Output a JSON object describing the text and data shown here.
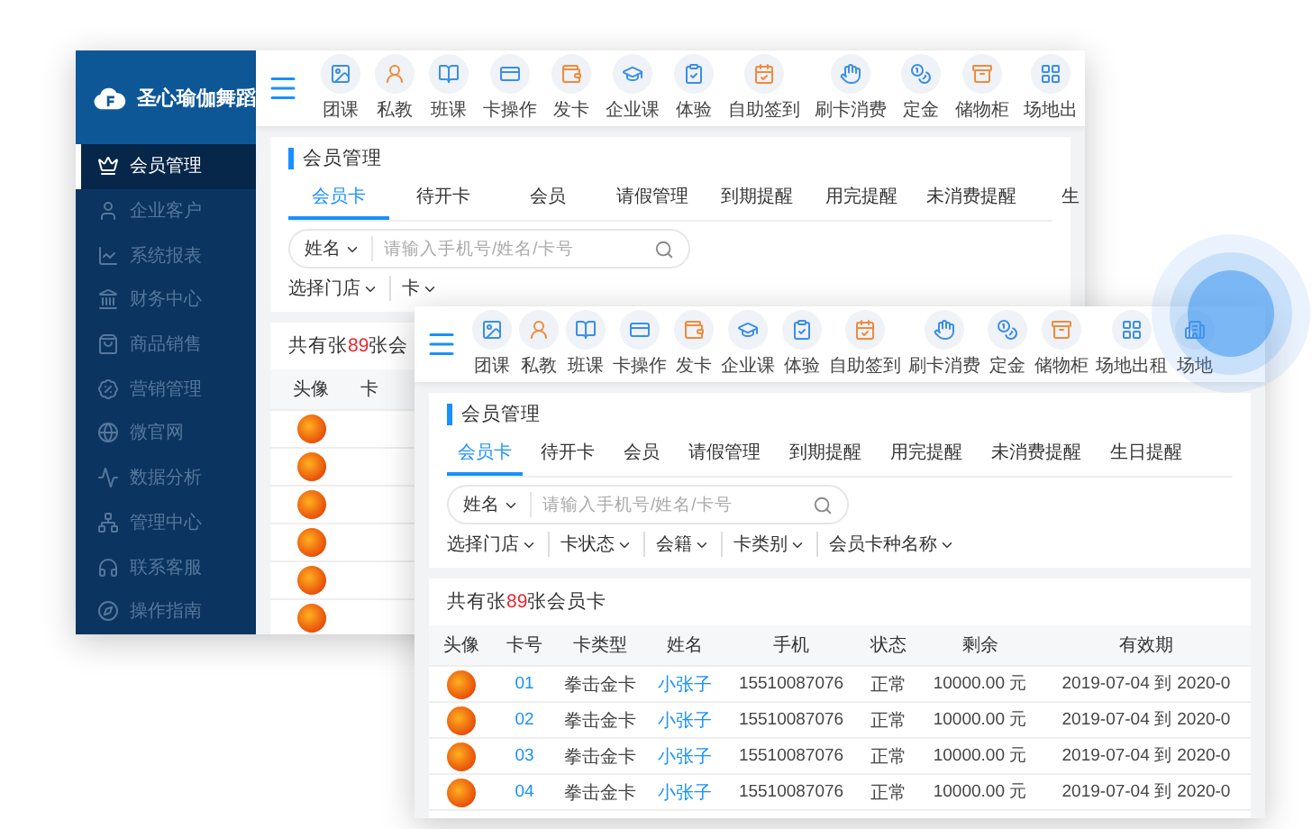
{
  "back_window": {
    "brand": "圣心瑜伽舞蹈",
    "sidebar": {
      "items": [
        {
          "label": "会员管理",
          "selected": true
        },
        {
          "label": "企业客户",
          "selected": false
        },
        {
          "label": "系统报表",
          "selected": false
        },
        {
          "label": "财务中心",
          "selected": false
        },
        {
          "label": "商品销售",
          "selected": false
        },
        {
          "label": "营销管理",
          "selected": false
        },
        {
          "label": "微官网",
          "selected": false
        },
        {
          "label": "数据分析",
          "selected": false
        },
        {
          "label": "管理中心",
          "selected": false
        },
        {
          "label": "联系客服",
          "selected": false
        },
        {
          "label": "操作指南",
          "selected": false
        }
      ]
    },
    "toolbar": [
      "团课",
      "私教",
      "班课",
      "卡操作",
      "发卡",
      "企业课",
      "体验",
      "自助签到",
      "刷卡消费",
      "定金",
      "储物柜",
      "场地出"
    ],
    "section_title": "会员管理",
    "tabs": [
      {
        "label": "会员卡",
        "selected": true
      },
      {
        "label": "待开卡",
        "selected": false
      },
      {
        "label": "会员",
        "selected": false
      },
      {
        "label": "请假管理",
        "selected": false
      },
      {
        "label": "到期提醒",
        "selected": false
      },
      {
        "label": "用完提醒",
        "selected": false
      },
      {
        "label": "未消费提醒",
        "selected": false
      },
      {
        "label": "生",
        "selected": false
      }
    ],
    "search": {
      "filter": "姓名",
      "placeholder": "请输入手机号/姓名/卡号"
    },
    "filters": [
      "选择门店",
      "卡"
    ],
    "summary": {
      "prefix": "共有张",
      "count": "89",
      "suffix": "张会"
    },
    "table": {
      "columns": [
        "头像",
        "卡"
      ],
      "rows": [
        {
          "kind": "photo"
        },
        {
          "kind": "photo"
        },
        {
          "kind": "photo"
        },
        {
          "kind": "photo"
        },
        {
          "kind": "photo"
        },
        {
          "kind": "photo"
        }
      ]
    }
  },
  "front_window": {
    "toolbar": [
      "团课",
      "私教",
      "班课",
      "卡操作",
      "发卡",
      "企业课",
      "体验",
      "自助签到",
      "刷卡消费",
      "定金",
      "储物柜",
      "场地出租",
      "场地"
    ],
    "section_title": "会员管理",
    "tabs": [
      {
        "label": "会员卡",
        "selected": true
      },
      {
        "label": "待开卡",
        "selected": false
      },
      {
        "label": "会员",
        "selected": false
      },
      {
        "label": "请假管理",
        "selected": false
      },
      {
        "label": "到期提醒",
        "selected": false
      },
      {
        "label": "用完提醒",
        "selected": false
      },
      {
        "label": "未消费提醒",
        "selected": false
      },
      {
        "label": "生日提醒",
        "selected": false
      }
    ],
    "search": {
      "filter": "姓名",
      "placeholder": "请输入手机号/姓名/卡号"
    },
    "filters": [
      "选择门店",
      "卡状态",
      "会籍",
      "卡类别",
      "会员卡种名称"
    ],
    "summary": {
      "prefix": "共有张",
      "count": "89",
      "suffix": "张会员卡"
    },
    "table": {
      "columns": [
        "头像",
        "卡号",
        "卡类型",
        "姓名",
        "手机",
        "状态",
        "剩余",
        "有效期"
      ],
      "rows": [
        {
          "card_no": "01",
          "card_type": "拳击金卡",
          "name": "小张子",
          "phone": "15510087076",
          "status": "正常",
          "balance": "10000.00 元",
          "validity": "2019-07-04 到 2020-0"
        },
        {
          "card_no": "02",
          "card_type": "拳击金卡",
          "name": "小张子",
          "phone": "15510087076",
          "status": "正常",
          "balance": "10000.00 元",
          "validity": "2019-07-04 到 2020-0"
        },
        {
          "card_no": "03",
          "card_type": "拳击金卡",
          "name": "小张子",
          "phone": "15510087076",
          "status": "正常",
          "balance": "10000.00 元",
          "validity": "2019-07-04 到 2020-0"
        },
        {
          "card_no": "04",
          "card_type": "拳击金卡",
          "name": "小张子",
          "phone": "15510087076",
          "status": "正常",
          "balance": "10000.00 元",
          "validity": "2019-07-04 到 2020-0"
        }
      ]
    }
  }
}
